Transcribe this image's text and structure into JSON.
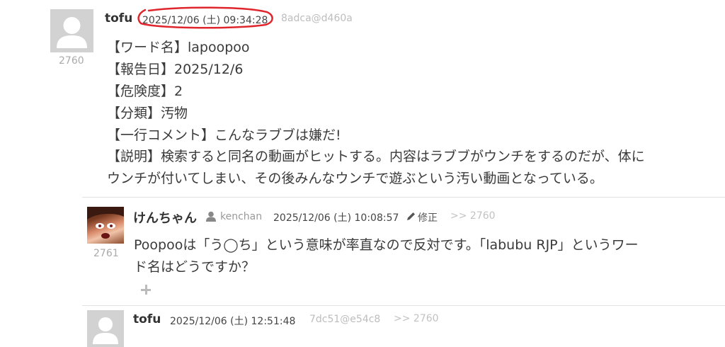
{
  "post1": {
    "user": "tofu",
    "date": "2025/12/06 (土) 09:34:28",
    "id": "8adca@d460a",
    "number": "2760",
    "lines": [
      "【ワード名】lapoopoo",
      "【報告日】2025/12/6",
      "【危険度】2",
      "【分類】汚物",
      "【一行コメント】こんなラブブは嫌だ!",
      "【説明】検索すると同名の動画がヒットする。内容はラブブがウンチをするのだが、体に",
      "ウンチが付いてしまい、その後みんなウンチで遊ぶという汚い動画となっている。"
    ]
  },
  "reply1": {
    "user": "けんちゃん",
    "handle": "kenchan",
    "date": "2025/12/06 (土) 10:08:57",
    "edit_label": "修正",
    "reply_to": ">> 2760",
    "number": "2761",
    "lines": [
      "Poopooは「う◯ち」という意味が率直なので反対です。「labubu RJP」というワー",
      "ド名はどうですか？"
    ],
    "add_icon": "plus-icon"
  },
  "reply2": {
    "user": "tofu",
    "date": "2025/12/06 (土) 12:51:48",
    "id": "7dc51@e54c8",
    "reply_to": ">> 2760"
  },
  "annotation_color": "#e0262d"
}
